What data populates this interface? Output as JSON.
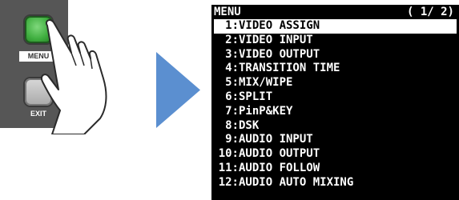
{
  "hardware": {
    "menu_button_label": "MENU",
    "exit_button_label": "EXIT",
    "menu_button_color": "#3fae3f",
    "exit_button_color": "#bdbdbd",
    "panel_color": "#565656"
  },
  "arrow_color": "#5b8fd0",
  "screen": {
    "title": "MENU",
    "page": "( 1/ 2)",
    "selected_index": 0,
    "items": [
      {
        "num": "1:",
        "label": "VIDEO ASSIGN"
      },
      {
        "num": "2:",
        "label": "VIDEO INPUT"
      },
      {
        "num": "3:",
        "label": "VIDEO OUTPUT"
      },
      {
        "num": "4:",
        "label": "TRANSITION TIME"
      },
      {
        "num": "5:",
        "label": "MIX/WIPE"
      },
      {
        "num": "6:",
        "label": "SPLIT"
      },
      {
        "num": "7:",
        "label": "PinP&KEY"
      },
      {
        "num": "8:",
        "label": "DSK"
      },
      {
        "num": "9:",
        "label": "AUDIO INPUT"
      },
      {
        "num": "10:",
        "label": "AUDIO OUTPUT"
      },
      {
        "num": "11:",
        "label": "AUDIO FOLLOW"
      },
      {
        "num": "12:",
        "label": "AUDIO AUTO MIXING"
      }
    ]
  }
}
